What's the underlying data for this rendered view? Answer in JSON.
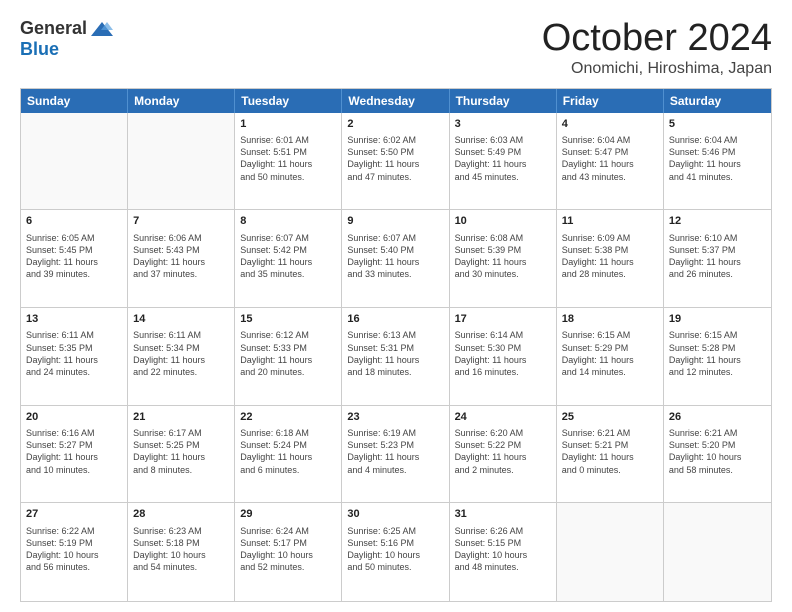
{
  "header": {
    "logo_general": "General",
    "logo_blue": "Blue",
    "month_title": "October 2024",
    "location": "Onomichi, Hiroshima, Japan"
  },
  "weekdays": [
    "Sunday",
    "Monday",
    "Tuesday",
    "Wednesday",
    "Thursday",
    "Friday",
    "Saturday"
  ],
  "rows": [
    [
      {
        "day": "",
        "lines": []
      },
      {
        "day": "",
        "lines": []
      },
      {
        "day": "1",
        "lines": [
          "Sunrise: 6:01 AM",
          "Sunset: 5:51 PM",
          "Daylight: 11 hours",
          "and 50 minutes."
        ]
      },
      {
        "day": "2",
        "lines": [
          "Sunrise: 6:02 AM",
          "Sunset: 5:50 PM",
          "Daylight: 11 hours",
          "and 47 minutes."
        ]
      },
      {
        "day": "3",
        "lines": [
          "Sunrise: 6:03 AM",
          "Sunset: 5:49 PM",
          "Daylight: 11 hours",
          "and 45 minutes."
        ]
      },
      {
        "day": "4",
        "lines": [
          "Sunrise: 6:04 AM",
          "Sunset: 5:47 PM",
          "Daylight: 11 hours",
          "and 43 minutes."
        ]
      },
      {
        "day": "5",
        "lines": [
          "Sunrise: 6:04 AM",
          "Sunset: 5:46 PM",
          "Daylight: 11 hours",
          "and 41 minutes."
        ]
      }
    ],
    [
      {
        "day": "6",
        "lines": [
          "Sunrise: 6:05 AM",
          "Sunset: 5:45 PM",
          "Daylight: 11 hours",
          "and 39 minutes."
        ]
      },
      {
        "day": "7",
        "lines": [
          "Sunrise: 6:06 AM",
          "Sunset: 5:43 PM",
          "Daylight: 11 hours",
          "and 37 minutes."
        ]
      },
      {
        "day": "8",
        "lines": [
          "Sunrise: 6:07 AM",
          "Sunset: 5:42 PM",
          "Daylight: 11 hours",
          "and 35 minutes."
        ]
      },
      {
        "day": "9",
        "lines": [
          "Sunrise: 6:07 AM",
          "Sunset: 5:40 PM",
          "Daylight: 11 hours",
          "and 33 minutes."
        ]
      },
      {
        "day": "10",
        "lines": [
          "Sunrise: 6:08 AM",
          "Sunset: 5:39 PM",
          "Daylight: 11 hours",
          "and 30 minutes."
        ]
      },
      {
        "day": "11",
        "lines": [
          "Sunrise: 6:09 AM",
          "Sunset: 5:38 PM",
          "Daylight: 11 hours",
          "and 28 minutes."
        ]
      },
      {
        "day": "12",
        "lines": [
          "Sunrise: 6:10 AM",
          "Sunset: 5:37 PM",
          "Daylight: 11 hours",
          "and 26 minutes."
        ]
      }
    ],
    [
      {
        "day": "13",
        "lines": [
          "Sunrise: 6:11 AM",
          "Sunset: 5:35 PM",
          "Daylight: 11 hours",
          "and 24 minutes."
        ]
      },
      {
        "day": "14",
        "lines": [
          "Sunrise: 6:11 AM",
          "Sunset: 5:34 PM",
          "Daylight: 11 hours",
          "and 22 minutes."
        ]
      },
      {
        "day": "15",
        "lines": [
          "Sunrise: 6:12 AM",
          "Sunset: 5:33 PM",
          "Daylight: 11 hours",
          "and 20 minutes."
        ]
      },
      {
        "day": "16",
        "lines": [
          "Sunrise: 6:13 AM",
          "Sunset: 5:31 PM",
          "Daylight: 11 hours",
          "and 18 minutes."
        ]
      },
      {
        "day": "17",
        "lines": [
          "Sunrise: 6:14 AM",
          "Sunset: 5:30 PM",
          "Daylight: 11 hours",
          "and 16 minutes."
        ]
      },
      {
        "day": "18",
        "lines": [
          "Sunrise: 6:15 AM",
          "Sunset: 5:29 PM",
          "Daylight: 11 hours",
          "and 14 minutes."
        ]
      },
      {
        "day": "19",
        "lines": [
          "Sunrise: 6:15 AM",
          "Sunset: 5:28 PM",
          "Daylight: 11 hours",
          "and 12 minutes."
        ]
      }
    ],
    [
      {
        "day": "20",
        "lines": [
          "Sunrise: 6:16 AM",
          "Sunset: 5:27 PM",
          "Daylight: 11 hours",
          "and 10 minutes."
        ]
      },
      {
        "day": "21",
        "lines": [
          "Sunrise: 6:17 AM",
          "Sunset: 5:25 PM",
          "Daylight: 11 hours",
          "and 8 minutes."
        ]
      },
      {
        "day": "22",
        "lines": [
          "Sunrise: 6:18 AM",
          "Sunset: 5:24 PM",
          "Daylight: 11 hours",
          "and 6 minutes."
        ]
      },
      {
        "day": "23",
        "lines": [
          "Sunrise: 6:19 AM",
          "Sunset: 5:23 PM",
          "Daylight: 11 hours",
          "and 4 minutes."
        ]
      },
      {
        "day": "24",
        "lines": [
          "Sunrise: 6:20 AM",
          "Sunset: 5:22 PM",
          "Daylight: 11 hours",
          "and 2 minutes."
        ]
      },
      {
        "day": "25",
        "lines": [
          "Sunrise: 6:21 AM",
          "Sunset: 5:21 PM",
          "Daylight: 11 hours",
          "and 0 minutes."
        ]
      },
      {
        "day": "26",
        "lines": [
          "Sunrise: 6:21 AM",
          "Sunset: 5:20 PM",
          "Daylight: 10 hours",
          "and 58 minutes."
        ]
      }
    ],
    [
      {
        "day": "27",
        "lines": [
          "Sunrise: 6:22 AM",
          "Sunset: 5:19 PM",
          "Daylight: 10 hours",
          "and 56 minutes."
        ]
      },
      {
        "day": "28",
        "lines": [
          "Sunrise: 6:23 AM",
          "Sunset: 5:18 PM",
          "Daylight: 10 hours",
          "and 54 minutes."
        ]
      },
      {
        "day": "29",
        "lines": [
          "Sunrise: 6:24 AM",
          "Sunset: 5:17 PM",
          "Daylight: 10 hours",
          "and 52 minutes."
        ]
      },
      {
        "day": "30",
        "lines": [
          "Sunrise: 6:25 AM",
          "Sunset: 5:16 PM",
          "Daylight: 10 hours",
          "and 50 minutes."
        ]
      },
      {
        "day": "31",
        "lines": [
          "Sunrise: 6:26 AM",
          "Sunset: 5:15 PM",
          "Daylight: 10 hours",
          "and 48 minutes."
        ]
      },
      {
        "day": "",
        "lines": []
      },
      {
        "day": "",
        "lines": []
      }
    ]
  ]
}
